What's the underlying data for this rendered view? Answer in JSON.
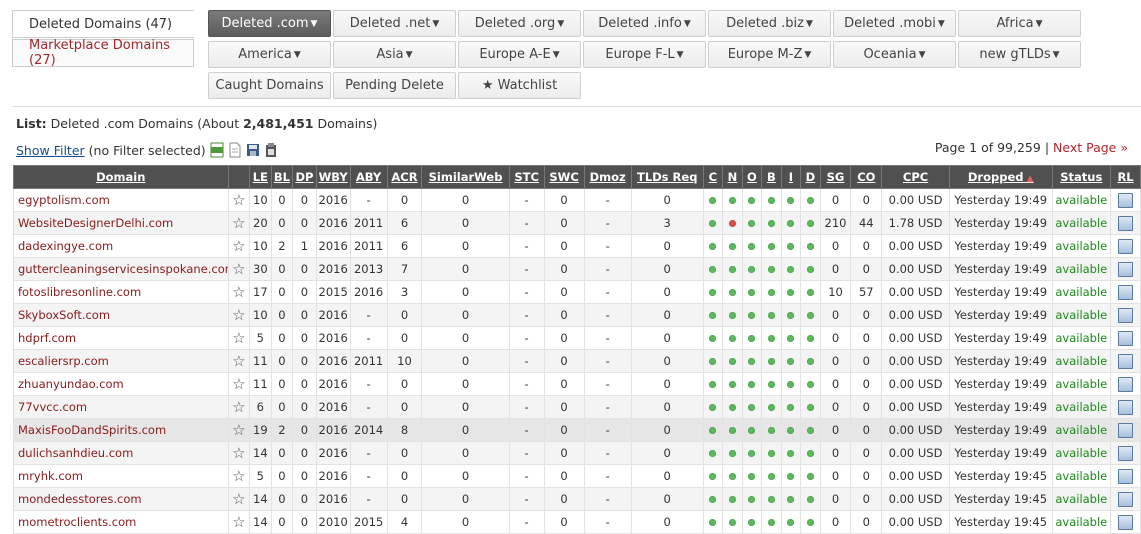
{
  "side_tabs": [
    {
      "label": "Deleted Domains (47)",
      "active": true
    },
    {
      "label": "Marketplace Domains (27)",
      "active": false
    }
  ],
  "categories": [
    {
      "label": "Deleted .com",
      "caret": true,
      "active": true
    },
    {
      "label": "Deleted .net",
      "caret": true
    },
    {
      "label": "Deleted .org",
      "caret": true
    },
    {
      "label": "Deleted .info",
      "caret": true
    },
    {
      "label": "Deleted .biz",
      "caret": true
    },
    {
      "label": "Deleted .mobi",
      "caret": true
    },
    {
      "label": "Africa",
      "caret": true
    },
    {
      "label": "America",
      "caret": true
    },
    {
      "label": "Asia",
      "caret": true
    },
    {
      "label": "Europe A-E",
      "caret": true
    },
    {
      "label": "Europe F-L",
      "caret": true
    },
    {
      "label": "Europe M-Z",
      "caret": true
    },
    {
      "label": "Oceania",
      "caret": true
    },
    {
      "label": "new gTLDs",
      "caret": true
    },
    {
      "label": "Caught Domains",
      "caret": false
    },
    {
      "label": "Pending Delete",
      "caret": false
    },
    {
      "label": "★ Watchlist",
      "caret": false
    }
  ],
  "list_info": {
    "prefix": "List:",
    "name": "Deleted .com Domains (About",
    "count": "2,481,451",
    "suffix": "Domains)"
  },
  "filter": {
    "link": "Show Filter",
    "state": "(no Filter selected)"
  },
  "pager": {
    "text": "Page 1 of 99,259",
    "separator": "|",
    "next": "Next Page »"
  },
  "columns": [
    "Domain",
    "",
    "LE",
    "BL",
    "DP",
    "WBY",
    "ABY",
    "ACR",
    "SimilarWeb",
    "STC",
    "SWC",
    "Dmoz",
    "TLDs Req",
    "C",
    "N",
    "O",
    "B",
    "I",
    "D",
    "SG",
    "CO",
    "CPC",
    "Dropped",
    "Status",
    "RL"
  ],
  "rows": [
    {
      "domain": "egyptolism.com",
      "le": "10",
      "bl": "0",
      "dp": "0",
      "wby": "2016",
      "aby": "-",
      "acr": "0",
      "sw": "0",
      "stc": "-",
      "swc": "0",
      "dmoz": "-",
      "tld": "0",
      "dots": [
        "g",
        "g",
        "g",
        "g",
        "g",
        "g"
      ],
      "sg": "0",
      "co": "0",
      "cpc": "0.00 USD",
      "dropped": "Yesterday 19:49",
      "status": "available"
    },
    {
      "domain": "WebsiteDesignerDelhi.com",
      "le": "20",
      "bl": "0",
      "dp": "0",
      "wby": "2016",
      "aby": "2011",
      "acr": "6",
      "sw": "0",
      "stc": "-",
      "swc": "0",
      "dmoz": "-",
      "tld": "3",
      "dots": [
        "g",
        "r",
        "g",
        "g",
        "g",
        "g"
      ],
      "sg": "210",
      "co": "44",
      "cpc": "1.78 USD",
      "dropped": "Yesterday 19:49",
      "status": "available"
    },
    {
      "domain": "dadexingye.com",
      "le": "10",
      "bl": "2",
      "dp": "1",
      "wby": "2016",
      "aby": "2011",
      "acr": "6",
      "sw": "0",
      "stc": "-",
      "swc": "0",
      "dmoz": "-",
      "tld": "0",
      "dots": [
        "g",
        "g",
        "g",
        "g",
        "g",
        "g"
      ],
      "sg": "0",
      "co": "0",
      "cpc": "0.00 USD",
      "dropped": "Yesterday 19:49",
      "status": "available"
    },
    {
      "domain": "guttercleaningservicesinspokane.com",
      "le": "30",
      "bl": "0",
      "dp": "0",
      "wby": "2016",
      "aby": "2013",
      "acr": "7",
      "sw": "0",
      "stc": "-",
      "swc": "0",
      "dmoz": "-",
      "tld": "0",
      "dots": [
        "g",
        "g",
        "g",
        "g",
        "g",
        "g"
      ],
      "sg": "0",
      "co": "0",
      "cpc": "0.00 USD",
      "dropped": "Yesterday 19:49",
      "status": "available"
    },
    {
      "domain": "fotoslibresonline.com",
      "le": "17",
      "bl": "0",
      "dp": "0",
      "wby": "2015",
      "aby": "2016",
      "acr": "3",
      "sw": "0",
      "stc": "-",
      "swc": "0",
      "dmoz": "-",
      "tld": "0",
      "dots": [
        "g",
        "g",
        "g",
        "g",
        "g",
        "g"
      ],
      "sg": "10",
      "co": "57",
      "cpc": "0.00 USD",
      "dropped": "Yesterday 19:49",
      "status": "available"
    },
    {
      "domain": "SkyboxSoft.com",
      "le": "10",
      "bl": "0",
      "dp": "0",
      "wby": "2016",
      "aby": "-",
      "acr": "0",
      "sw": "0",
      "stc": "-",
      "swc": "0",
      "dmoz": "-",
      "tld": "0",
      "dots": [
        "g",
        "g",
        "g",
        "g",
        "g",
        "g"
      ],
      "sg": "0",
      "co": "0",
      "cpc": "0.00 USD",
      "dropped": "Yesterday 19:49",
      "status": "available"
    },
    {
      "domain": "hdprf.com",
      "le": "5",
      "bl": "0",
      "dp": "0",
      "wby": "2016",
      "aby": "-",
      "acr": "0",
      "sw": "0",
      "stc": "-",
      "swc": "0",
      "dmoz": "-",
      "tld": "0",
      "dots": [
        "g",
        "g",
        "g",
        "g",
        "g",
        "g"
      ],
      "sg": "0",
      "co": "0",
      "cpc": "0.00 USD",
      "dropped": "Yesterday 19:49",
      "status": "available"
    },
    {
      "domain": "escaliersrp.com",
      "le": "11",
      "bl": "0",
      "dp": "0",
      "wby": "2016",
      "aby": "2011",
      "acr": "10",
      "sw": "0",
      "stc": "-",
      "swc": "0",
      "dmoz": "-",
      "tld": "0",
      "dots": [
        "g",
        "g",
        "g",
        "g",
        "g",
        "g"
      ],
      "sg": "0",
      "co": "0",
      "cpc": "0.00 USD",
      "dropped": "Yesterday 19:49",
      "status": "available"
    },
    {
      "domain": "zhuanyundao.com",
      "le": "11",
      "bl": "0",
      "dp": "0",
      "wby": "2016",
      "aby": "-",
      "acr": "0",
      "sw": "0",
      "stc": "-",
      "swc": "0",
      "dmoz": "-",
      "tld": "0",
      "dots": [
        "g",
        "g",
        "g",
        "g",
        "g",
        "g"
      ],
      "sg": "0",
      "co": "0",
      "cpc": "0.00 USD",
      "dropped": "Yesterday 19:49",
      "status": "available"
    },
    {
      "domain": "77vvcc.com",
      "le": "6",
      "bl": "0",
      "dp": "0",
      "wby": "2016",
      "aby": "-",
      "acr": "0",
      "sw": "0",
      "stc": "-",
      "swc": "0",
      "dmoz": "-",
      "tld": "0",
      "dots": [
        "g",
        "g",
        "g",
        "g",
        "g",
        "g"
      ],
      "sg": "0",
      "co": "0",
      "cpc": "0.00 USD",
      "dropped": "Yesterday 19:49",
      "status": "available"
    },
    {
      "domain": "MaxisFooDandSpirits.com",
      "le": "19",
      "bl": "2",
      "dp": "0",
      "wby": "2016",
      "aby": "2014",
      "acr": "8",
      "sw": "0",
      "stc": "-",
      "swc": "0",
      "dmoz": "-",
      "tld": "0",
      "dots": [
        "g",
        "g",
        "g",
        "g",
        "g",
        "g"
      ],
      "sg": "0",
      "co": "0",
      "cpc": "0.00 USD",
      "dropped": "Yesterday 19:49",
      "status": "available",
      "hl": true
    },
    {
      "domain": "dulichsanhdieu.com",
      "le": "14",
      "bl": "0",
      "dp": "0",
      "wby": "2016",
      "aby": "-",
      "acr": "0",
      "sw": "0",
      "stc": "-",
      "swc": "0",
      "dmoz": "-",
      "tld": "0",
      "dots": [
        "g",
        "g",
        "g",
        "g",
        "g",
        "g"
      ],
      "sg": "0",
      "co": "0",
      "cpc": "0.00 USD",
      "dropped": "Yesterday 19:49",
      "status": "available"
    },
    {
      "domain": "mryhk.com",
      "le": "5",
      "bl": "0",
      "dp": "0",
      "wby": "2016",
      "aby": "-",
      "acr": "0",
      "sw": "0",
      "stc": "-",
      "swc": "0",
      "dmoz": "-",
      "tld": "0",
      "dots": [
        "g",
        "g",
        "g",
        "g",
        "g",
        "g"
      ],
      "sg": "0",
      "co": "0",
      "cpc": "0.00 USD",
      "dropped": "Yesterday 19:45",
      "status": "available"
    },
    {
      "domain": "mondedesstores.com",
      "le": "14",
      "bl": "0",
      "dp": "0",
      "wby": "2016",
      "aby": "-",
      "acr": "0",
      "sw": "0",
      "stc": "-",
      "swc": "0",
      "dmoz": "-",
      "tld": "0",
      "dots": [
        "g",
        "g",
        "g",
        "g",
        "g",
        "g"
      ],
      "sg": "0",
      "co": "0",
      "cpc": "0.00 USD",
      "dropped": "Yesterday 19:45",
      "status": "available"
    },
    {
      "domain": "mometroclients.com",
      "le": "14",
      "bl": "0",
      "dp": "0",
      "wby": "2010",
      "aby": "2015",
      "acr": "4",
      "sw": "0",
      "stc": "-",
      "swc": "0",
      "dmoz": "-",
      "tld": "0",
      "dots": [
        "g",
        "g",
        "g",
        "g",
        "g",
        "g"
      ],
      "sg": "0",
      "co": "0",
      "cpc": "0.00 USD",
      "dropped": "Yesterday 19:45",
      "status": "available"
    }
  ],
  "colors": {
    "header_bg": "#505050",
    "domain_link": "#8b1a1a",
    "available": "#1a8a1a",
    "dot_green": "#5cb85c",
    "dot_red": "#e04a4a",
    "active_btn": "#5c5c5c"
  }
}
